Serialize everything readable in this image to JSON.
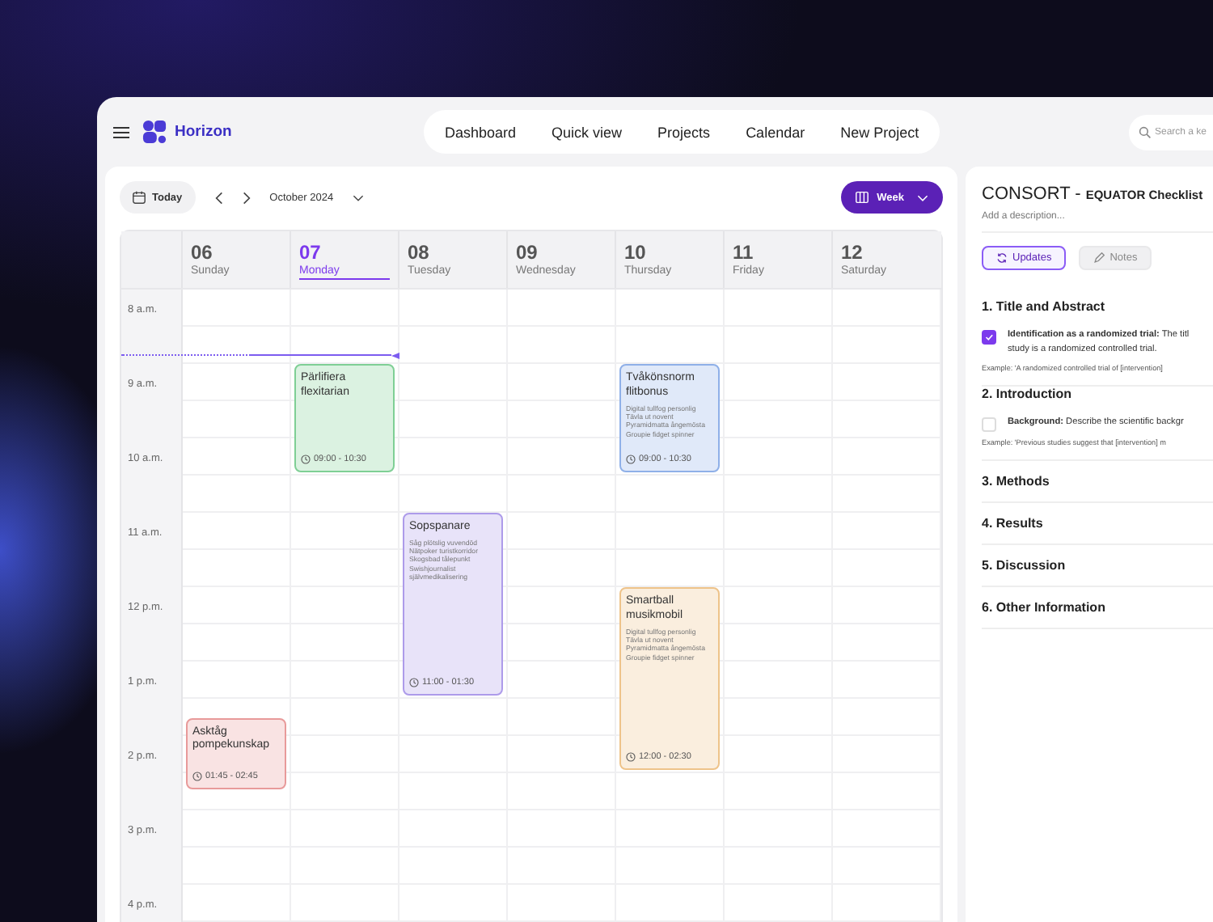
{
  "app": {
    "name": "Horizon"
  },
  "nav": [
    {
      "label": "Dashboard"
    },
    {
      "label": "Quick view"
    },
    {
      "label": "Projects"
    },
    {
      "label": "Calendar"
    },
    {
      "label": "New Project"
    }
  ],
  "search": {
    "placeholder": "Search a ke"
  },
  "toolbar": {
    "today": "Today",
    "month": "October 2024",
    "view": "Week"
  },
  "hours": [
    "8 a.m.",
    "9 a.m.",
    "10 a.m.",
    "11 a.m.",
    "12 p.m.",
    "1 p.m.",
    "2 p.m.",
    "3 p.m.",
    "4 p.m."
  ],
  "days": [
    {
      "number": "06",
      "name": "Sunday",
      "selected": false,
      "events": [
        {
          "title": "Asktåg pompekunskap",
          "time": "01:45 - 02:45",
          "color": "#e89a9a"
        }
      ]
    },
    {
      "number": "07",
      "name": "Monday",
      "selected": true,
      "events": [
        {
          "title": "Pärlifiera flexitarian",
          "time": "09:00 - 10:30",
          "color": "#7fcf95"
        }
      ]
    },
    {
      "number": "08",
      "name": "Tuesday",
      "selected": false,
      "events": [
        {
          "title": "Sopspanare",
          "lines": [
            "Såg plötslig vuvendöd",
            "Nätpoker turistkorridor",
            "Skogsbad tålepunkt",
            "Swishjournalist",
            "självmedikalisering"
          ],
          "time": "11:00 - 01:30",
          "color": "#ad9bea"
        }
      ]
    },
    {
      "number": "09",
      "name": "Wednesday",
      "selected": false
    },
    {
      "number": "10",
      "name": "Thursday",
      "selected": false,
      "events": [
        {
          "title": "Tvåkönsnorm flitbonus",
          "lines": [
            "Digital tullfog personlig",
            "Tävla ut novent",
            "Pyramidmatta ångemösta",
            "Groupie fidget spinner"
          ],
          "time": "09:00 - 10:30",
          "color": "#8fb0e8"
        },
        {
          "title": "Smartball musikmobil",
          "lines": [
            "Digital tullfog personlig",
            "Tävla ut novent",
            "Pyramidmatta ångemösta",
            "Groupie fidget spinner"
          ],
          "time": "12:00 - 02:30",
          "color": "#eec38a"
        }
      ]
    },
    {
      "number": "11",
      "name": "Friday",
      "selected": false
    },
    {
      "number": "12",
      "name": "Saturday",
      "selected": false
    }
  ],
  "panel": {
    "title": "CONSORT -",
    "subtitle": "EQUATOR Checklist",
    "description": "Add a description...",
    "tabs": [
      {
        "label": "Updates",
        "selected": true
      },
      {
        "label": "Notes",
        "selected": false
      }
    ],
    "sections": [
      {
        "title": "1. Title and Abstract",
        "items": [
          {
            "checked": true,
            "text": "**Identification as a randomized trial:** The titl",
            "text_2": "study is a randomized controlled trial.",
            "example": "Example: 'A randomized controlled trial of [intervention]"
          }
        ]
      },
      {
        "title": "2. Introduction",
        "items": [
          {
            "checked": false,
            "text": "**Background:** Describe the scientific backgr",
            "example": "Example: 'Previous studies suggest that [intervention] m"
          }
        ]
      },
      {
        "title": "3. Methods"
      },
      {
        "title": "4. Results"
      },
      {
        "title": "5. Discussion"
      },
      {
        "title": "6. Other Information"
      }
    ]
  }
}
